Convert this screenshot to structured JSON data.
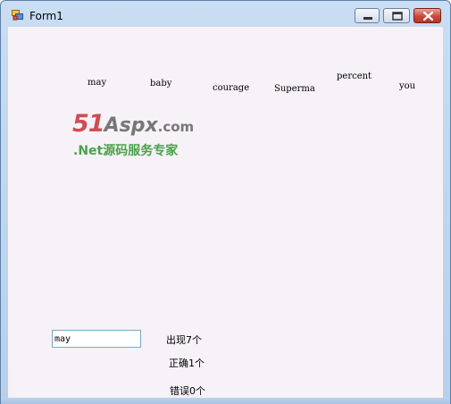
{
  "window": {
    "title": "Form1"
  },
  "words": [
    "may",
    "baby",
    "courage",
    "Superma",
    "percent",
    "you"
  ],
  "logo": {
    "top_part1": "51",
    "top_part2": "Aspx",
    "top_part3": ".com",
    "bottom": ".Net源码服务专家"
  },
  "input": {
    "value": "may"
  },
  "results": {
    "appear": "出现7个",
    "correct": "正确1个",
    "wrong": "错误0个"
  },
  "colors": {
    "client_bg": "#f6f2f7",
    "logo_red": "#cf4d52",
    "logo_green": "#4aa14a",
    "close_red": "#c84a3c"
  }
}
